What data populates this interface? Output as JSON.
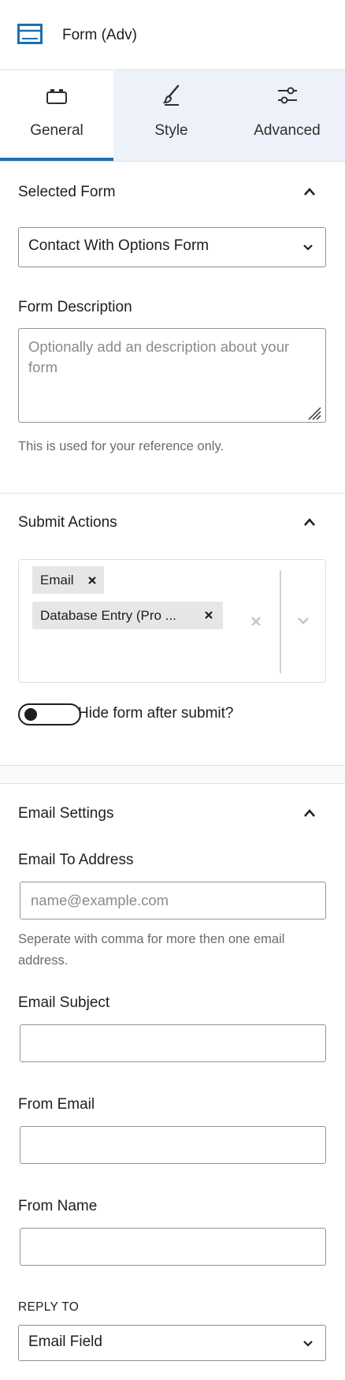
{
  "header": {
    "title": "Form (Adv)",
    "icon": "form-block-icon"
  },
  "tabs": [
    {
      "label": "General",
      "icon": "general-tab-icon",
      "active": true
    },
    {
      "label": "Style",
      "icon": "brush-icon",
      "active": false
    },
    {
      "label": "Advanced",
      "icon": "sliders-icon",
      "active": false
    }
  ],
  "selected_form": {
    "title": "Selected Form",
    "select_value": "Contact With Options Form",
    "description_label": "Form Description",
    "description_placeholder": "Optionally add an description about your form",
    "help": "This is used for your reference only."
  },
  "submit_actions": {
    "title": "Submit Actions",
    "tags": [
      "Email",
      "Database Entry (Pro ..."
    ],
    "toggle_label": "Hide form after submit?",
    "toggle_on": false
  },
  "email_settings": {
    "title": "Email Settings",
    "to_label": "Email To Address",
    "to_placeholder": "name@example.com",
    "to_help": "Seperate with comma for more then one email address.",
    "subject_label": "Email Subject",
    "from_email_label": "From Email",
    "from_name_label": "From Name",
    "reply_to_label": "REPLY TO",
    "reply_to_value": "Email Field"
  },
  "colors": {
    "accent": "#1d6fb1",
    "tab_bg": "#edf2fa"
  }
}
